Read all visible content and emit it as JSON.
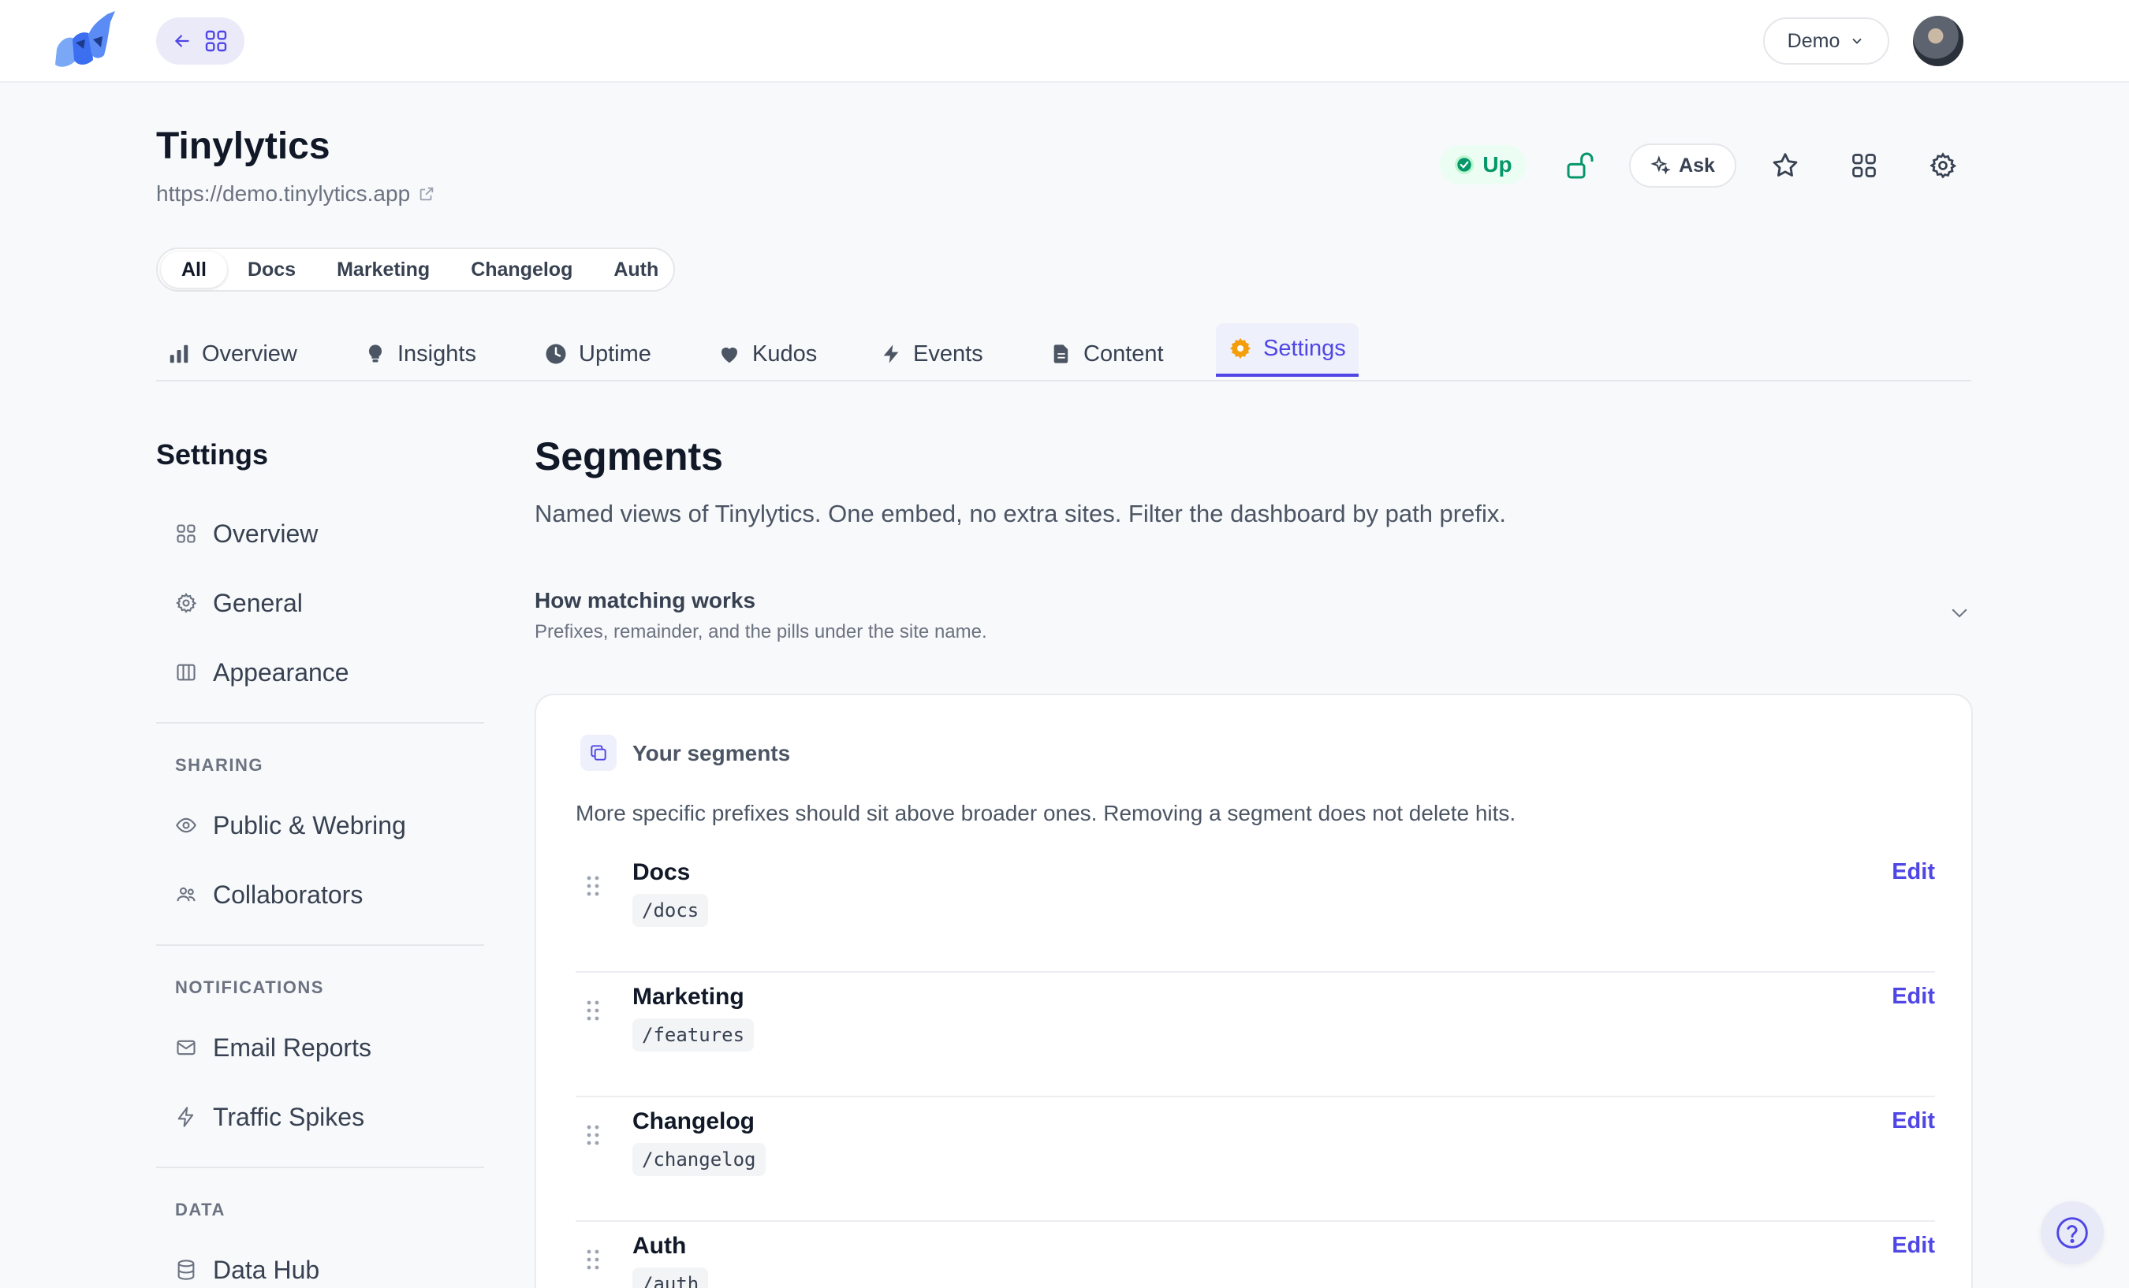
{
  "topbar": {
    "workspace": "Demo"
  },
  "site": {
    "title": "Tinylytics",
    "url": "https://demo.tinylytics.app",
    "status": "Up",
    "ask_label": "Ask",
    "segments": [
      "All",
      "Docs",
      "Marketing",
      "Changelog",
      "Auth"
    ],
    "active_segment": "All"
  },
  "tabs": [
    {
      "label": "Overview",
      "icon": "bar-chart-icon"
    },
    {
      "label": "Insights",
      "icon": "lightbulb-icon"
    },
    {
      "label": "Uptime",
      "icon": "clock-icon"
    },
    {
      "label": "Kudos",
      "icon": "heart-icon"
    },
    {
      "label": "Events",
      "icon": "bolt-icon"
    },
    {
      "label": "Content",
      "icon": "document-icon"
    },
    {
      "label": "Settings",
      "icon": "gear-icon",
      "active": true
    }
  ],
  "sidebar": {
    "title": "Settings",
    "items": [
      {
        "label": "Overview",
        "icon": "grid-icon"
      },
      {
        "label": "General",
        "icon": "gear-icon"
      },
      {
        "label": "Appearance",
        "icon": "columns-icon"
      }
    ],
    "sections": [
      {
        "title": "SHARING",
        "items": [
          {
            "label": "Public & Webring",
            "icon": "eye-icon"
          },
          {
            "label": "Collaborators",
            "icon": "users-icon"
          }
        ]
      },
      {
        "title": "NOTIFICATIONS",
        "items": [
          {
            "label": "Email Reports",
            "icon": "mail-icon"
          },
          {
            "label": "Traffic Spikes",
            "icon": "bolt-icon"
          }
        ]
      },
      {
        "title": "DATA",
        "items": [
          {
            "label": "Data Hub",
            "icon": "database-icon"
          }
        ]
      }
    ]
  },
  "main": {
    "title": "Segments",
    "description": "Named views of Tinylytics. One embed, no extra sites. Filter the dashboard by path prefix.",
    "how": {
      "title": "How matching works",
      "subtitle": "Prefixes, remainder, and the pills under the site name."
    },
    "card": {
      "title": "Your segments",
      "description": "More specific prefixes should sit above broader ones. Removing a segment does not delete hits.",
      "edit_label": "Edit",
      "rows": [
        {
          "name": "Docs",
          "prefix": "/docs"
        },
        {
          "name": "Marketing",
          "prefix": "/features"
        },
        {
          "name": "Changelog",
          "prefix": "/changelog"
        },
        {
          "name": "Auth",
          "prefix": "/auth"
        }
      ]
    }
  },
  "colors": {
    "accent": "#4f46e5",
    "success": "#059669",
    "warning": "#f59e0b"
  }
}
